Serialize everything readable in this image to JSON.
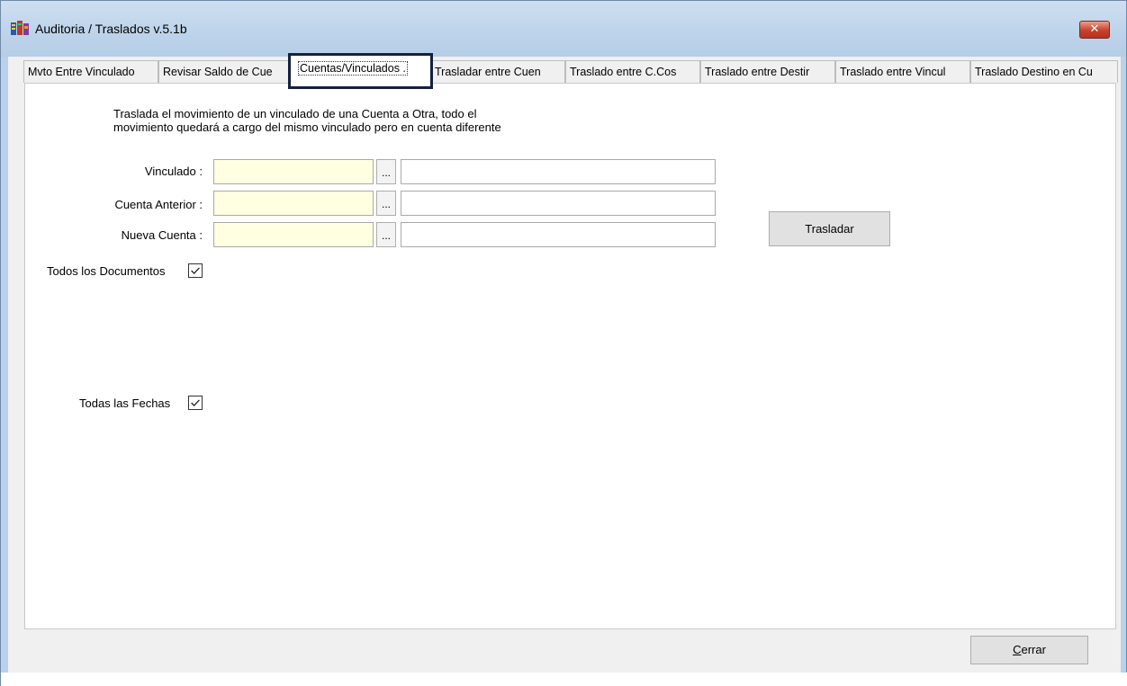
{
  "window": {
    "title": "Auditoria / Traslados  v.5.1b",
    "close_label": "✕"
  },
  "tabs": [
    {
      "label": "Mvto Entre Vinculado"
    },
    {
      "label": "Revisar Saldo de Cue"
    },
    {
      "label": "Cuentas/Vinculados ."
    },
    {
      "label": "Trasladar entre Cuen"
    },
    {
      "label": "Traslado entre C.Cos"
    },
    {
      "label": "Traslado entre Destir"
    },
    {
      "label": "Traslado entre Vincul"
    },
    {
      "label": "Traslado Destino en Cu"
    }
  ],
  "active_tab_index": 2,
  "panel": {
    "description_line1": "Traslada el movimiento de un vinculado de una Cuenta a Otra, todo el",
    "description_line2": "movimiento quedará a cargo del mismo vinculado pero en cuenta diferente",
    "fields": [
      {
        "label": "Vinculado :",
        "code_value": "",
        "name_value": "",
        "browse_label": "..."
      },
      {
        "label": "Cuenta Anterior :",
        "code_value": "",
        "name_value": "",
        "browse_label": "..."
      },
      {
        "label": "Nueva Cuenta :",
        "code_value": "",
        "name_value": "",
        "browse_label": "..."
      }
    ],
    "trasladar_label": "Trasladar",
    "todos_documentos_label": "Todos los Documentos",
    "todos_documentos_checked": true,
    "todas_fechas_label": "Todas las Fechas",
    "todas_fechas_checked": true
  },
  "footer": {
    "cerrar_label": "Cerrar",
    "cerrar_accel": "C",
    "cerrar_rest": "errar"
  },
  "colors": {
    "titlebar": "#bcd3ea",
    "input_highlight": "#ffffe1",
    "active_tab_border": "#14203f",
    "close_button": "#c7402a"
  }
}
